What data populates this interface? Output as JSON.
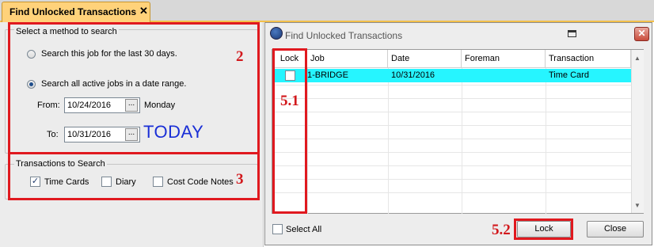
{
  "tab": {
    "title": "Find Unlocked Transactions",
    "close": "✕"
  },
  "search_method": {
    "legend": "Select a method to search",
    "option_job": "Search this job for the last 30 days.",
    "option_range": "Search all active jobs in a date range.",
    "selected": "option_range",
    "from_label": "From:",
    "from_value": "10/24/2016",
    "from_day": "Monday",
    "to_label": "To:",
    "to_value": "10/31/2016",
    "today_text": "TODAY",
    "date_button": "..."
  },
  "transactions": {
    "legend": "Transactions to Search",
    "time_cards": {
      "label": "Time Cards",
      "checked": true
    },
    "diary": {
      "label": "Diary",
      "checked": false
    },
    "cost_code_notes": {
      "label": "Cost Code Notes",
      "checked": false
    }
  },
  "annotations": {
    "a2": "2",
    "a3": "3",
    "a51": "5.1",
    "a52": "5.2",
    "color": "#e0191f"
  },
  "dialog": {
    "title": "Find Unlocked Transactions",
    "columns": [
      "Lock",
      "Job",
      "Date",
      "Foreman",
      "Transaction"
    ],
    "rows": [
      {
        "lock": false,
        "job": "1-BRIDGE",
        "date": "10/31/2016",
        "foreman": "",
        "transaction": "Time Card"
      }
    ],
    "row_highlight": "#26f5ff",
    "select_all_label": "Select All",
    "lock_button": "Lock",
    "close_button": "Close"
  }
}
